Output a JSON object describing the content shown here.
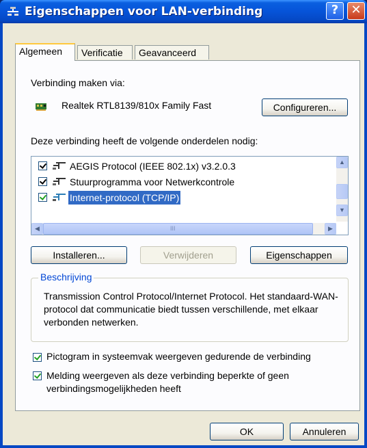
{
  "window": {
    "title": "Eigenschappen voor LAN-verbinding",
    "help_label": "?",
    "close_label": "✕"
  },
  "tabs": [
    {
      "label": "Algemeen",
      "active": true
    },
    {
      "label": "Verificatie",
      "active": false
    },
    {
      "label": "Geavanceerd",
      "active": false
    }
  ],
  "connect_via": {
    "label": "Verbinding maken via:",
    "adapter_name": "Realtek RTL8139/810x Family Fast",
    "configure_button": "Configureren..."
  },
  "components": {
    "label": "Deze verbinding heeft de volgende onderdelen nodig:",
    "items": [
      {
        "label": "AEGIS Protocol (IEEE 802.1x) v3.2.0.3",
        "checked": true,
        "selected": false
      },
      {
        "label": "Stuurprogramma voor Netwerkcontrole",
        "checked": true,
        "selected": false
      },
      {
        "label": "Internet-protocol (TCP/IP)",
        "checked": true,
        "selected": true
      }
    ],
    "scroll_grip": "III"
  },
  "actions": {
    "install": "Installeren...",
    "remove": "Verwijderen",
    "properties": "Eigenschappen"
  },
  "description": {
    "legend": "Beschrijving",
    "text": "Transmission Control Protocol/Internet Protocol. Het standaard-WAN-protocol dat communicatie biedt tussen verschillende, met elkaar verbonden netwerken."
  },
  "options": {
    "show_icon": {
      "label": "Pictogram in systeemvak weergeven gedurende de verbinding",
      "checked": true
    },
    "notify_limited": {
      "label": "Melding weergeven als deze verbinding beperkte of geen verbindingsmogelijkheden heeft",
      "checked": true
    }
  },
  "footer": {
    "ok": "OK",
    "cancel": "Annuleren"
  },
  "colors": {
    "titlebar": "#0653d8",
    "dialog_bg": "#ece9d8",
    "selection": "#316ac5",
    "legend": "#0046d5",
    "checkmark": "#21a121"
  }
}
